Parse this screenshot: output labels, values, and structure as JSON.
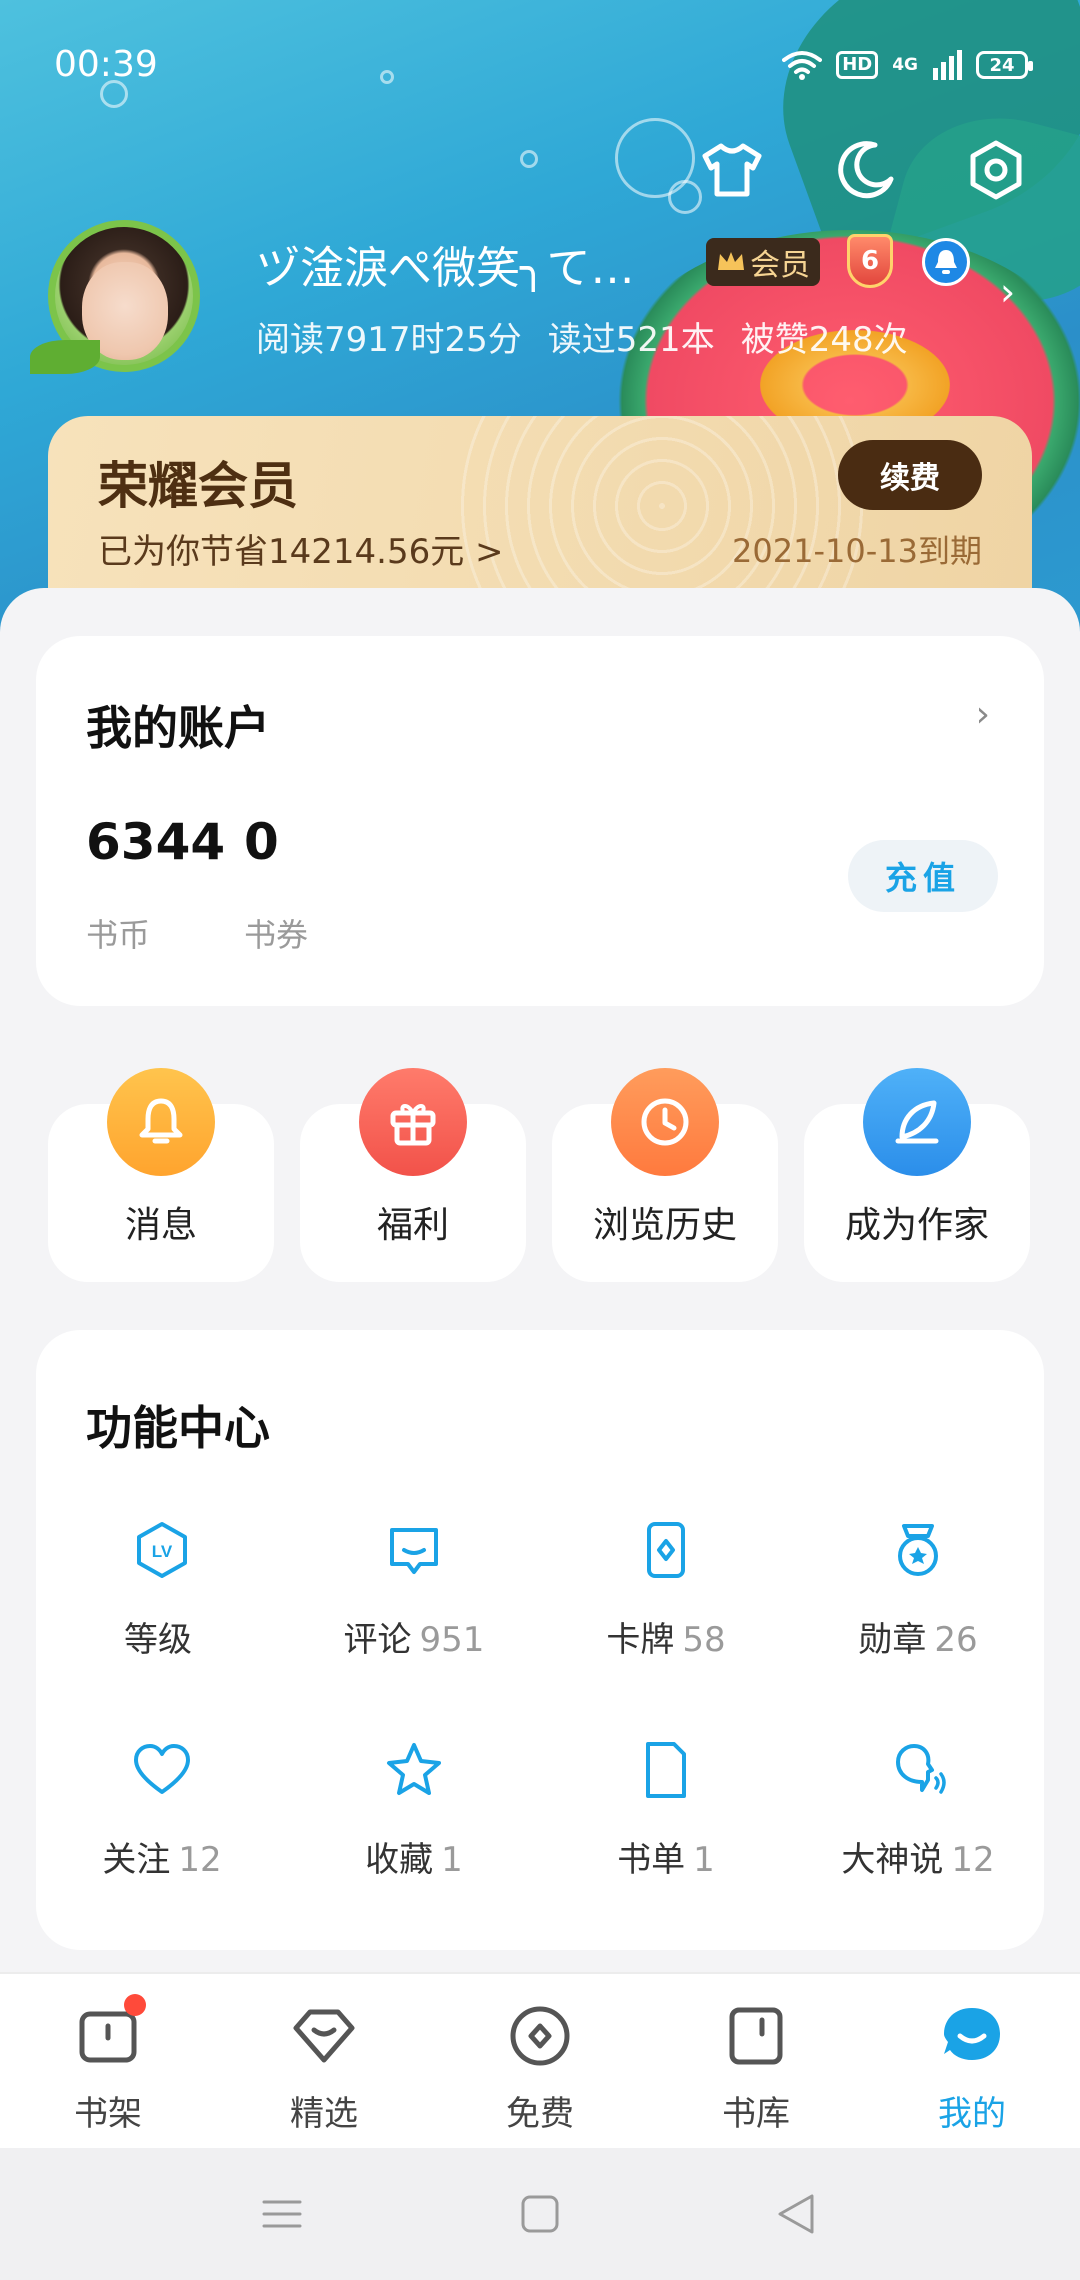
{
  "status_bar": {
    "time": "00:39",
    "hd_label": "HD",
    "network_label": "4G",
    "battery_level": "24"
  },
  "top_actions": {
    "icons": [
      "shirt-icon",
      "moon-icon",
      "settings-icon"
    ]
  },
  "profile": {
    "username": "ヅ淦淚ぺ微笑╮て…",
    "vip_badge_label": "会员",
    "level": "6",
    "stats": {
      "reading_time": "阅读7917时25分",
      "books_read": "读过521本",
      "likes": "被赞248次"
    }
  },
  "vip_card": {
    "title": "荣耀会员",
    "saving": "已为你节省14214.56元 >",
    "renew_label": "续费",
    "expire": "2021-10-13到期"
  },
  "account": {
    "title": "我的账户",
    "coins_value": "6344",
    "coins_label": "书币",
    "vouchers_value": "0",
    "vouchers_label": "书券",
    "recharge_label": "充值"
  },
  "quick_actions": [
    {
      "label": "消息",
      "icon": "bell-icon",
      "color": "#ffb13d"
    },
    {
      "label": "福利",
      "icon": "gift-icon",
      "color": "#ff6a5a"
    },
    {
      "label": "浏览历史",
      "icon": "clock-icon",
      "color": "#ff8a4c"
    },
    {
      "label": "成为作家",
      "icon": "feather-icon",
      "color": "#3a9ef2"
    }
  ],
  "feature_center": {
    "title": "功能中心",
    "items": [
      {
        "label": "等级",
        "count": "",
        "icon": "level-icon"
      },
      {
        "label": "评论",
        "count": "951",
        "icon": "comment-icon"
      },
      {
        "label": "卡牌",
        "count": "58",
        "icon": "card-icon"
      },
      {
        "label": "勋章",
        "count": "26",
        "icon": "medal-icon"
      },
      {
        "label": "关注",
        "count": "12",
        "icon": "heart-icon"
      },
      {
        "label": "收藏",
        "count": "1",
        "icon": "star-icon"
      },
      {
        "label": "书单",
        "count": "1",
        "icon": "booklist-icon"
      },
      {
        "label": "大神说",
        "count": "12",
        "icon": "speak-icon"
      }
    ]
  },
  "bottom_nav": {
    "items": [
      {
        "label": "书架",
        "icon": "bookshelf-icon"
      },
      {
        "label": "精选",
        "icon": "featured-icon"
      },
      {
        "label": "免费",
        "icon": "free-icon"
      },
      {
        "label": "书库",
        "icon": "library-icon"
      },
      {
        "label": "我的",
        "icon": "mine-icon"
      }
    ],
    "active": "我的"
  },
  "colors": {
    "accent": "#1aa3e6",
    "header_blue": "#2fa8d6",
    "vip_gold": "#f3dcb1",
    "vip_brown": "#4a2c12",
    "notification_red": "#ff4a3a"
  }
}
